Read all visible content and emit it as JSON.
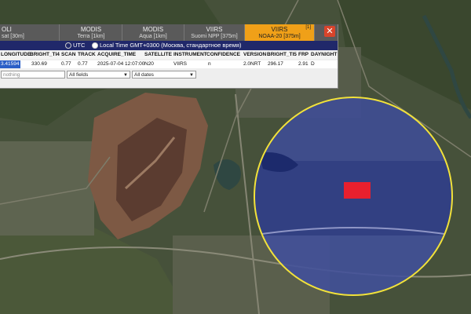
{
  "tabs": [
    {
      "title": "OLI",
      "subtitle": "sat [30m]",
      "active": false
    },
    {
      "title": "MODIS",
      "subtitle": "Terra [1km]",
      "active": false
    },
    {
      "title": "MODIS",
      "subtitle": "Aqua [1km]",
      "active": false
    },
    {
      "title": "VIIRS",
      "subtitle": "Suomi NPP [375m]",
      "active": false
    },
    {
      "title": "VIIRS",
      "subtitle": "NOAA-20 [375m]",
      "active": true,
      "badge": "[1]"
    }
  ],
  "close_label": "✕",
  "timezone": {
    "utc_label": "UTC",
    "local_label": "Local Time GMT+0300 (Москва, стандартное время)",
    "selected": "local"
  },
  "columns": [
    "LONGITUDE",
    "BRIGHT_TI4",
    "SCAN",
    "TRACK",
    "ACQUIRE_TIME",
    "SATELLITE",
    "INSTRUMENT",
    "CONFIDENCE",
    "VERSION",
    "BRIGHT_TI5",
    "FRP",
    "DAYNIGHT"
  ],
  "row": [
    "3.41594",
    "330.69",
    "0.77",
    "0.77",
    "2025-07-04 12:07:00",
    "N20",
    "VIIRS",
    "n",
    "2.0NRT",
    "296.17",
    "2.91",
    "D"
  ],
  "filters": {
    "search_placeholder": "nothing",
    "fields_value": "All fields",
    "dates_value": "All dates"
  },
  "colors": {
    "active_tab": "#f0a018",
    "tz_bar": "#20286a",
    "highlight_circle_fill": "#2b3a9e",
    "highlight_circle_stroke": "#f2e23a",
    "fire_pixel": "#e8202e",
    "selected_cell": "#2a5fc7",
    "close_button": "#d9442b"
  }
}
